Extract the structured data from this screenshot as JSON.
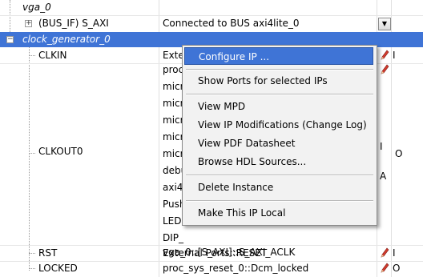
{
  "tree": {
    "vga": {
      "name": "vga_0"
    },
    "bus": {
      "name": "(BUS_IF) S_AXI",
      "value": "Connected to BUS axi4lite_0"
    },
    "clockgen": {
      "name": "clock_generator_0"
    },
    "clkin": {
      "name": "CLKIN",
      "value": "Exte"
    },
    "clkout0": {
      "name": "CLKOUT0",
      "direction": "O"
    },
    "clkout_values": [
      "proc",
      "micr",
      "micr",
      "micr",
      "micr",
      "micr",
      "debu",
      "axi4",
      "Push",
      "LEDs",
      "DIP_",
      "vga_0::[S_AXI]::S_AXI_ACLK"
    ],
    "clkout_right_fragments": [
      "I",
      "A"
    ],
    "clkin_direction": "I",
    "rst": {
      "name": "RST",
      "value": "External Ports::RESET",
      "direction": "I"
    },
    "locked": {
      "name": "LOCKED",
      "value": "proc_sys_reset_0::Dcm_locked",
      "direction": "O"
    }
  },
  "context_menu": {
    "items": [
      {
        "label": "Configure IP ..."
      },
      {
        "label": "Show Ports for selected IPs"
      },
      {
        "label": "View MPD"
      },
      {
        "label": "View IP Modifications (Change Log)"
      },
      {
        "label": "View PDF Datasheet"
      },
      {
        "label": "Browse HDL Sources..."
      },
      {
        "label": "Delete Instance"
      },
      {
        "label": "Make This IP Local"
      }
    ]
  },
  "colors": {
    "selection": "#3f74d6",
    "pencil": "#c0392b"
  }
}
